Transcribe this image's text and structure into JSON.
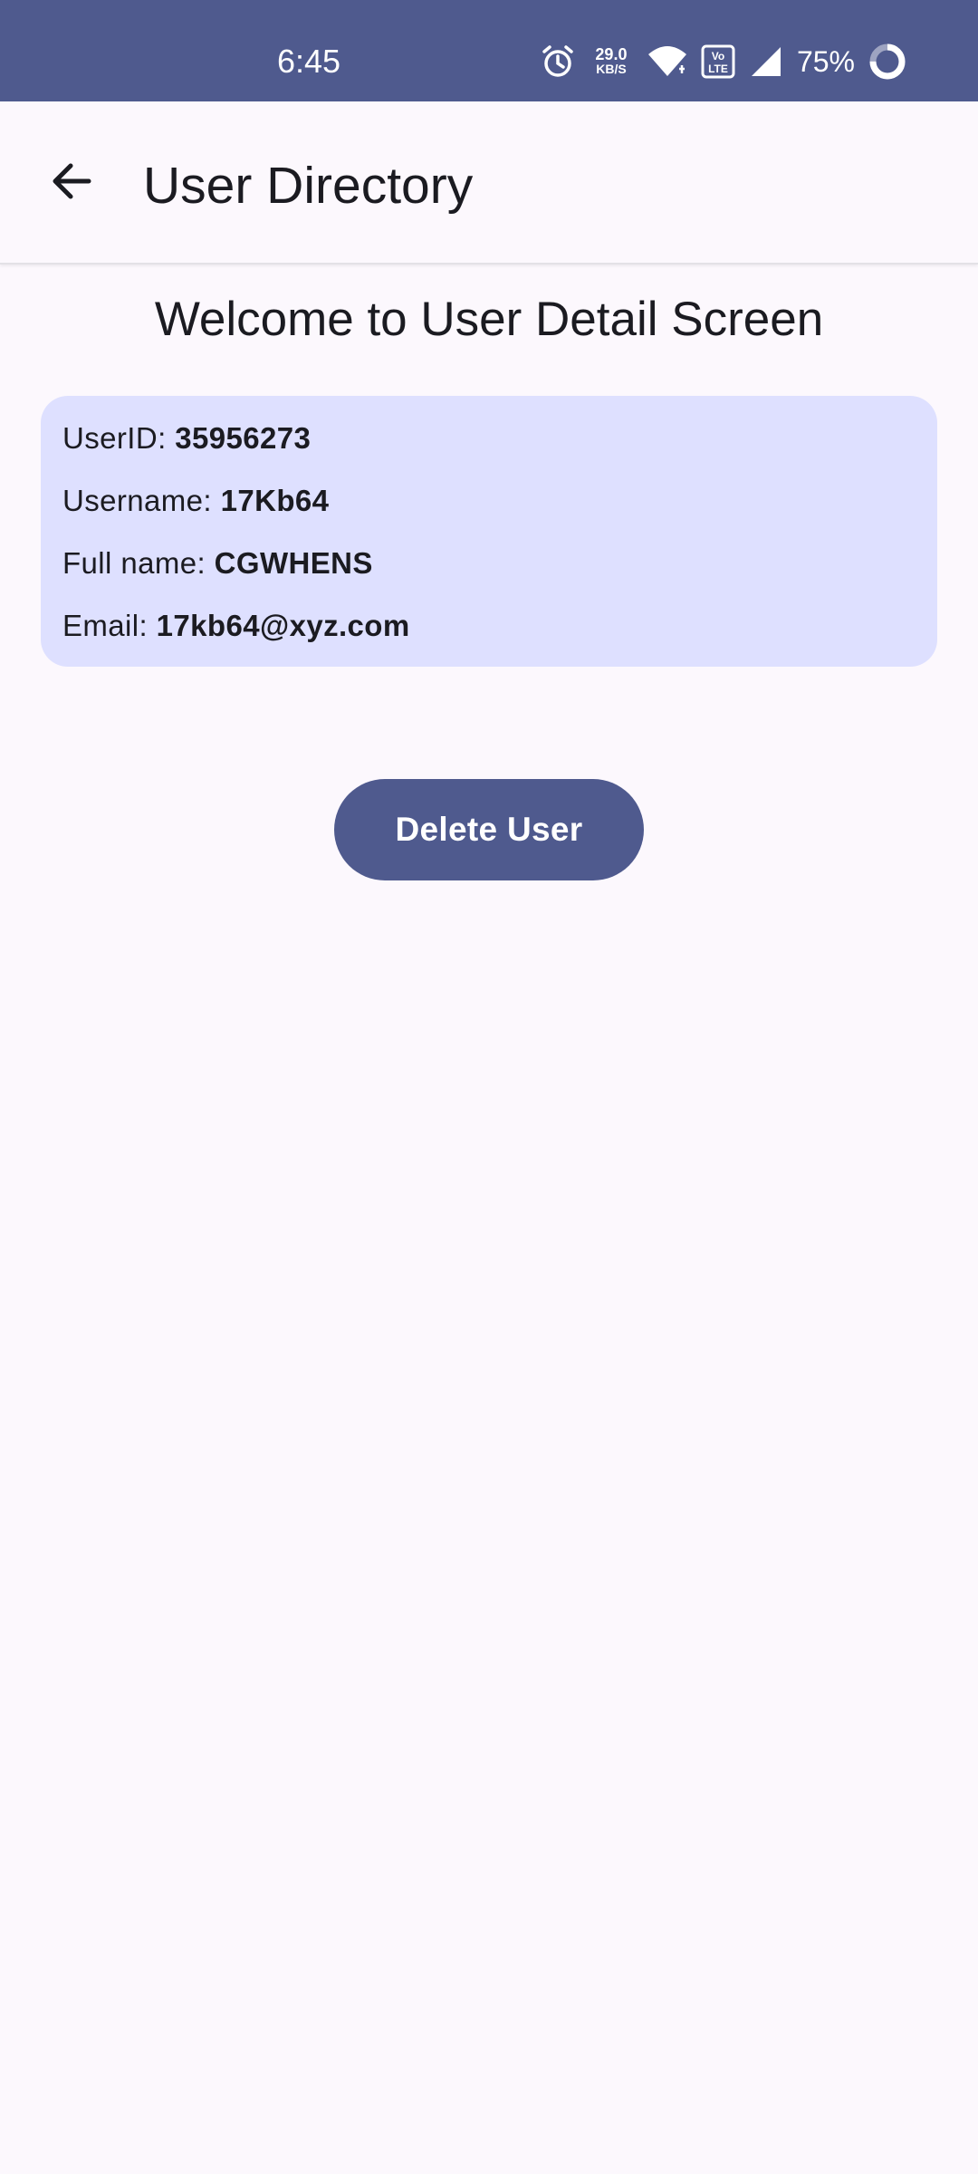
{
  "status_bar": {
    "time": "6:45",
    "net_speed_value": "29.0",
    "net_speed_unit": "KB/S",
    "battery_percent": "75%",
    "icons": [
      "alarm-icon",
      "wifi-icon",
      "volte-icon",
      "signal-icon",
      "battery-ring-icon"
    ]
  },
  "app_bar": {
    "title": "User Directory",
    "back_icon": "arrow-back-icon"
  },
  "main": {
    "welcome": "Welcome to User Detail Screen",
    "user": {
      "user_id_label": "UserID:",
      "user_id": "35956273",
      "username_label": "Username:",
      "username": "17Kb64",
      "full_name_label": "Full name:",
      "full_name": "CGWHENS",
      "email_label": "Email:",
      "email": "17kb64@xyz.com"
    },
    "delete_button_label": "Delete User"
  },
  "colors": {
    "primary": "#4f5a8e",
    "card_background": "#dee0ff",
    "surface": "#fcf8fd",
    "text": "#1b1b21"
  }
}
